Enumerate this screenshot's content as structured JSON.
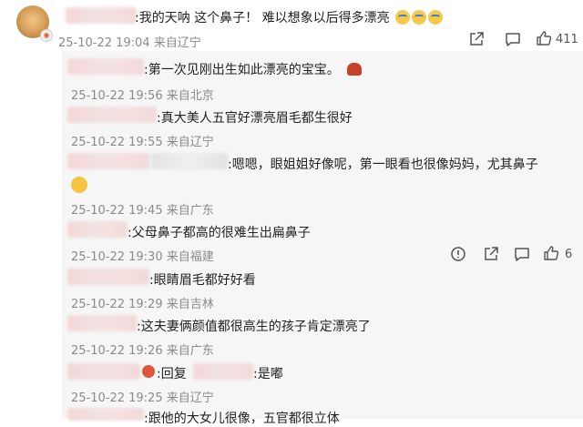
{
  "main_comment": {
    "text": ":我的天呐  这个鼻子！ 难以想象以后得多漂亮",
    "emoji_name": "crying-emoji",
    "emoji_count": 3,
    "meta": "25-10-22 19:04 来自辽宁",
    "like_count": "411"
  },
  "replies": [
    {
      "text": ":第一次见刚出生如此漂亮的宝宝。",
      "meta": "25-10-22 19:56 来自北京"
    },
    {
      "text": ":真大美人五官好漂亮眉毛都生很好",
      "meta": "25-10-22 19:55 来自辽宁"
    },
    {
      "text": ":嗯嗯，眼姐姐好像呢，第一眼看也很像妈妈，尤其鼻子",
      "meta": "25-10-22 19:45 来自广东"
    },
    {
      "text": ":父母鼻子都高的很难生出扁鼻子",
      "meta": "25-10-22 19:30 来自福建",
      "like_count": "6"
    },
    {
      "text": ":眼睛眉毛都好好看",
      "meta": "25-10-22 19:29 来自吉林"
    },
    {
      "text": ":这夫妻俩颜值都很高生的孩子肯定漂亮了",
      "meta": "25-10-22 19:26 来自广东"
    },
    {
      "text_prefix": ":回复",
      "text": ":是嘟",
      "meta": "25-10-22 19:25 来自辽宁"
    },
    {
      "text": ":跟他的大女儿很像，五官都很立体"
    }
  ],
  "colors": {
    "meta_gray": "#8a8a8a",
    "reply_bg": "#f6f6f6",
    "blur_pink": "#f6d6d6",
    "icon_gray": "#555555"
  }
}
